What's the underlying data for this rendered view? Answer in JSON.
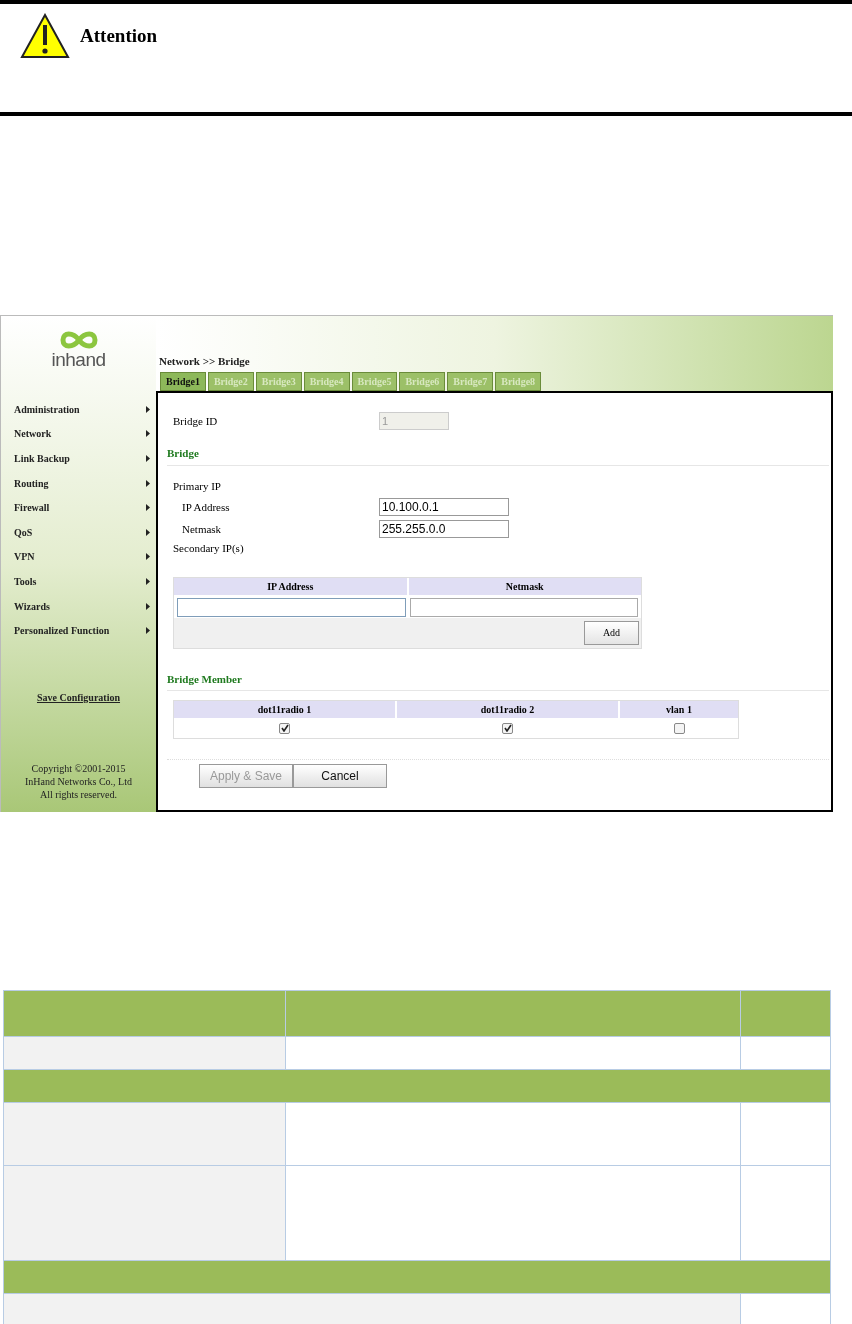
{
  "notice": {
    "title": "Attention"
  },
  "app": {
    "logo": "inhand",
    "breadcrumb": "Network >> Bridge",
    "tabs": [
      {
        "label": "Bridge1",
        "selected": true
      },
      {
        "label": "Bridge2",
        "selected": false
      },
      {
        "label": "Bridge3",
        "selected": false
      },
      {
        "label": "Bridge4",
        "selected": false
      },
      {
        "label": "Bridge5",
        "selected": false
      },
      {
        "label": "Bridge6",
        "selected": false
      },
      {
        "label": "Bridge7",
        "selected": false
      },
      {
        "label": "Bridge8",
        "selected": false
      }
    ],
    "menu": [
      "Administration",
      "Network",
      "Link Backup",
      "Routing",
      "Firewall",
      "QoS",
      "VPN",
      "Tools",
      "Wizards",
      "Personalized Function"
    ],
    "save_link": "Save Configuration",
    "copyright": [
      "Copyright ©2001-2015",
      "InHand Networks Co., Ltd",
      "All rights reserved."
    ],
    "bridge_id": {
      "label": "Bridge ID",
      "value": "1",
      "disabled": true
    },
    "bridge_section": "Bridge",
    "primary_ip": "Primary IP",
    "ip_address": {
      "label": "IP Address",
      "value": "10.100.0.1"
    },
    "netmask": {
      "label": "Netmask",
      "value": "255.255.0.0"
    },
    "secondary_ip": "Secondary IP(s)",
    "secondary_table": {
      "columns": [
        "IP Address",
        "Netmask"
      ],
      "add": "Add"
    },
    "member_section": "Bridge Member",
    "members": [
      {
        "label": "dot11radio 1",
        "checked": true
      },
      {
        "label": "dot11radio 2",
        "checked": true
      },
      {
        "label": "vlan 1",
        "checked": false
      }
    ],
    "buttons": [
      {
        "label": "Apply & Save",
        "disabled": true
      },
      {
        "label": "Cancel",
        "disabled": false
      }
    ]
  },
  "doc_table": {
    "rows": [
      {
        "kind": "header"
      },
      {
        "kind": "single"
      },
      {
        "kind": "group"
      },
      {
        "kind": "double"
      },
      {
        "kind": "triple"
      },
      {
        "kind": "group"
      },
      {
        "kind": "span"
      }
    ]
  }
}
